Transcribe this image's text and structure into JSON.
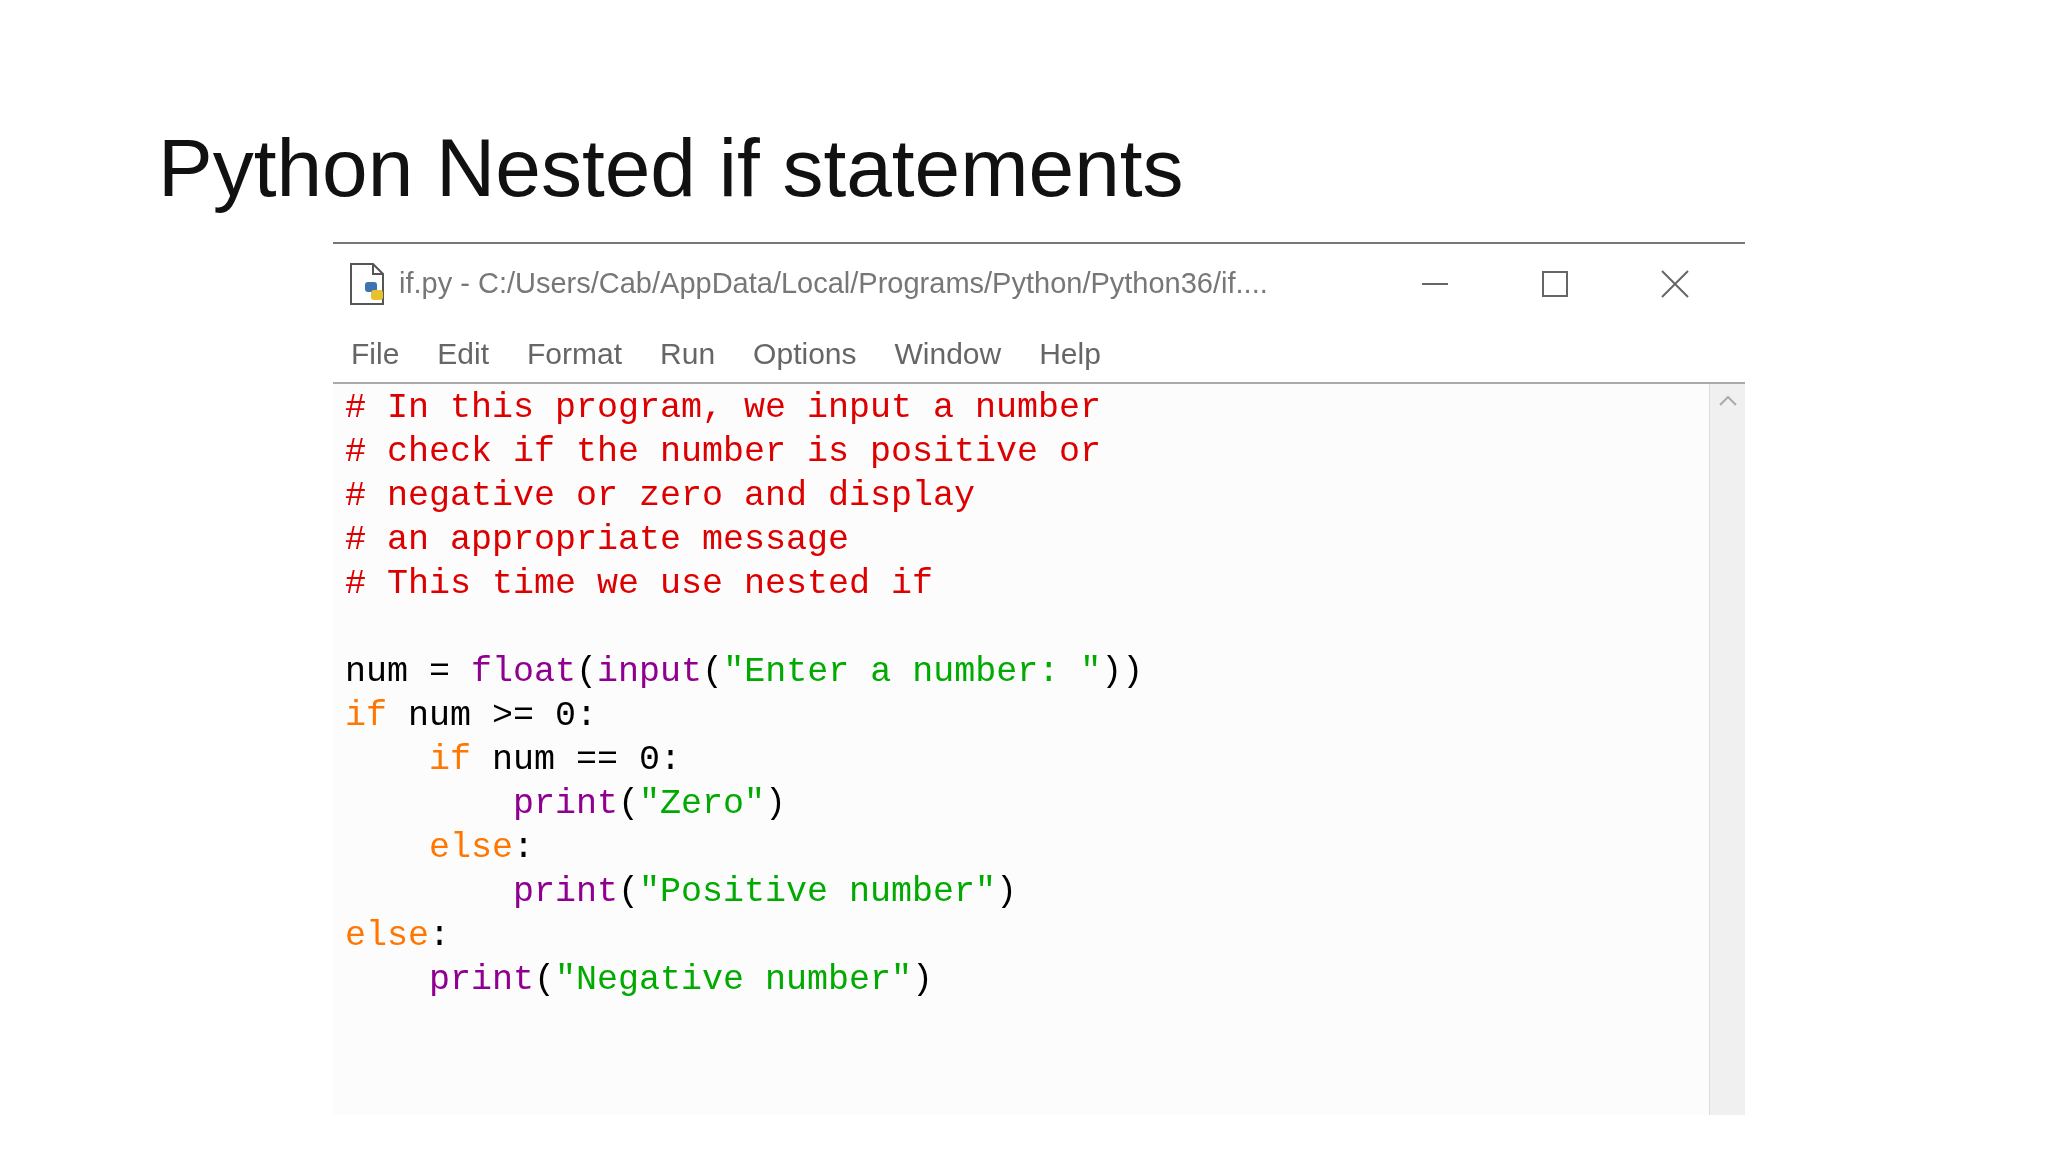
{
  "slide_title": "Python Nested if statements",
  "window": {
    "title": "if.py - C:/Users/Cab/AppData/Local/Programs/Python/Python36/if...."
  },
  "menu": [
    "File",
    "Edit",
    "Format",
    "Run",
    "Options",
    "Window",
    "Help"
  ],
  "code_lines": [
    {
      "kind": "code",
      "tokens": [
        {
          "kind": "comment",
          "text": "# In this program, we input a number"
        }
      ]
    },
    {
      "kind": "code",
      "tokens": [
        {
          "kind": "comment",
          "text": "# check if the number is positive or"
        }
      ]
    },
    {
      "kind": "code",
      "tokens": [
        {
          "kind": "comment",
          "text": "# negative or zero and display"
        }
      ]
    },
    {
      "kind": "code",
      "tokens": [
        {
          "kind": "comment",
          "text": "# an appropriate message"
        }
      ]
    },
    {
      "kind": "code",
      "tokens": [
        {
          "kind": "comment",
          "text": "# This time we use nested if"
        }
      ]
    },
    {
      "kind": "blank"
    },
    {
      "kind": "code",
      "tokens": [
        {
          "kind": "plain",
          "text": "num = "
        },
        {
          "kind": "builtin",
          "text": "float"
        },
        {
          "kind": "plain",
          "text": "("
        },
        {
          "kind": "builtin",
          "text": "input"
        },
        {
          "kind": "plain",
          "text": "("
        },
        {
          "kind": "string",
          "text": "\"Enter a number: \""
        },
        {
          "kind": "plain",
          "text": "))"
        }
      ]
    },
    {
      "kind": "code",
      "tokens": [
        {
          "kind": "keyword",
          "text": "if"
        },
        {
          "kind": "plain",
          "text": " num >= 0:"
        }
      ],
      "children": [
        {
          "kind": "code",
          "tokens": [
            {
              "kind": "keyword",
              "text": "if"
            },
            {
              "kind": "plain",
              "text": " num == 0:"
            }
          ],
          "children": [
            {
              "kind": "code",
              "tokens": [
                {
                  "kind": "builtin",
                  "text": "print"
                },
                {
                  "kind": "plain",
                  "text": "("
                },
                {
                  "kind": "string",
                  "text": "\"Zero\""
                },
                {
                  "kind": "plain",
                  "text": ")"
                }
              ]
            }
          ]
        },
        {
          "kind": "code",
          "tokens": [
            {
              "kind": "keyword",
              "text": "else"
            },
            {
              "kind": "plain",
              "text": ":"
            }
          ],
          "children": [
            {
              "kind": "code",
              "tokens": [
                {
                  "kind": "builtin",
                  "text": "print"
                },
                {
                  "kind": "plain",
                  "text": "("
                },
                {
                  "kind": "string",
                  "text": "\"Positive number\""
                },
                {
                  "kind": "plain",
                  "text": ")"
                }
              ]
            }
          ]
        }
      ]
    },
    {
      "kind": "code",
      "tokens": [
        {
          "kind": "keyword",
          "text": "else"
        },
        {
          "kind": "plain",
          "text": ":"
        }
      ],
      "children": [
        {
          "kind": "code",
          "tokens": [
            {
              "kind": "builtin",
              "text": "print"
            },
            {
              "kind": "plain",
              "text": "("
            },
            {
              "kind": "string",
              "text": "\"Negative number\""
            },
            {
              "kind": "plain",
              "text": ")"
            }
          ]
        }
      ]
    }
  ]
}
